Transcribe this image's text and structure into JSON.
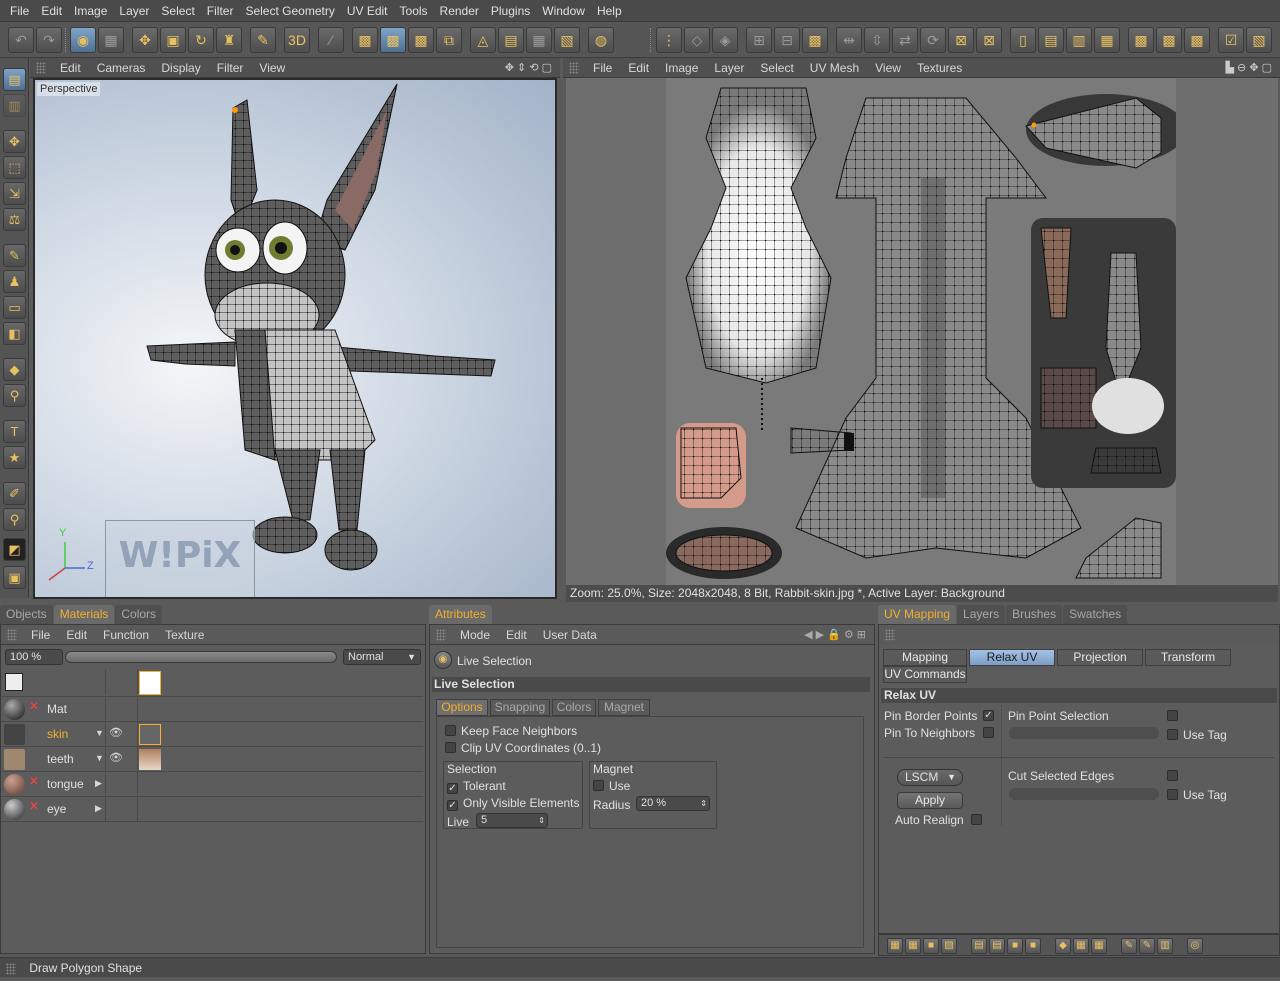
{
  "menubar": [
    "File",
    "Edit",
    "Image",
    "Layer",
    "Select",
    "Filter",
    "Select Geometry",
    "UV Edit",
    "Tools",
    "Render",
    "Plugins",
    "Window",
    "Help"
  ],
  "viewport": {
    "menu": [
      "Edit",
      "Cameras",
      "Display",
      "Filter",
      "View"
    ],
    "label": "Perspective",
    "watermark": "W!PiX",
    "axis_y": "Y",
    "axis_z": "Z"
  },
  "texture_view": {
    "menu": [
      "File",
      "Edit",
      "Image",
      "Layer",
      "Select",
      "UV Mesh",
      "View",
      "Textures"
    ],
    "status": "Zoom: 25.0%, Size: 2048x2048, 8 Bit, Rabbit-skin.jpg *, Active Layer: Background"
  },
  "materials_panel": {
    "tabs": [
      "Objects",
      "Materials",
      "Colors"
    ],
    "active_tab": "Materials",
    "menu": [
      "File",
      "Edit",
      "Function",
      "Texture"
    ],
    "zoom": "100 %",
    "blend_mode": "Normal",
    "materials": [
      {
        "name": "Mat",
        "color": "#1a1a1a"
      },
      {
        "name": "skin",
        "color": "#5a5a5a"
      },
      {
        "name": "teeth",
        "color": "#b09070"
      },
      {
        "name": "tongue",
        "color": "#8a5a4a"
      },
      {
        "name": "eye",
        "color": "#3a3a3a"
      }
    ]
  },
  "attributes_panel": {
    "tab": "Attributes",
    "menu": [
      "Mode",
      "Edit",
      "User Data"
    ],
    "tool_name": "Live Selection",
    "section_title": "Live Selection",
    "subtabs": [
      "Options",
      "Snapping",
      "Colors",
      "Magnet"
    ],
    "active_subtab": "Options",
    "keep_face_neighbors": "Keep Face Neighbors",
    "clip_uv": "Clip UV Coordinates (0..1)",
    "selection_group": "Selection",
    "tolerant": "Tolerant",
    "tolerant_check": "✓",
    "only_visible": "Only Visible Elements",
    "only_visible_check": "✓",
    "live_label": "Live",
    "live_value": "5",
    "magnet_group": "Magnet",
    "use_label": "Use",
    "radius_label": "Radius",
    "radius_value": "20 %"
  },
  "uv_panel": {
    "tabs": [
      "UV Mapping",
      "Layers",
      "Brushes",
      "Swatches"
    ],
    "active_tab": "UV Mapping",
    "subtabs": [
      "Mapping",
      "Relax UV",
      "Projection",
      "Transform"
    ],
    "active_subtab": "Relax UV",
    "uv_commands": "UV Commands",
    "section_title": "Relax UV",
    "pin_border_points": "Pin Border Points",
    "pin_border_check": "✓",
    "pin_to_neighbors": "Pin To Neighbors",
    "pin_point_selection": "Pin Point Selection",
    "use_tag": "Use Tag",
    "method": "LSCM",
    "apply": "Apply",
    "auto_realign": "Auto Realign",
    "cut_selected_edges": "Cut Selected Edges",
    "use_tag_2": "Use Tag"
  },
  "status_bar": "Draw Polygon Shape"
}
